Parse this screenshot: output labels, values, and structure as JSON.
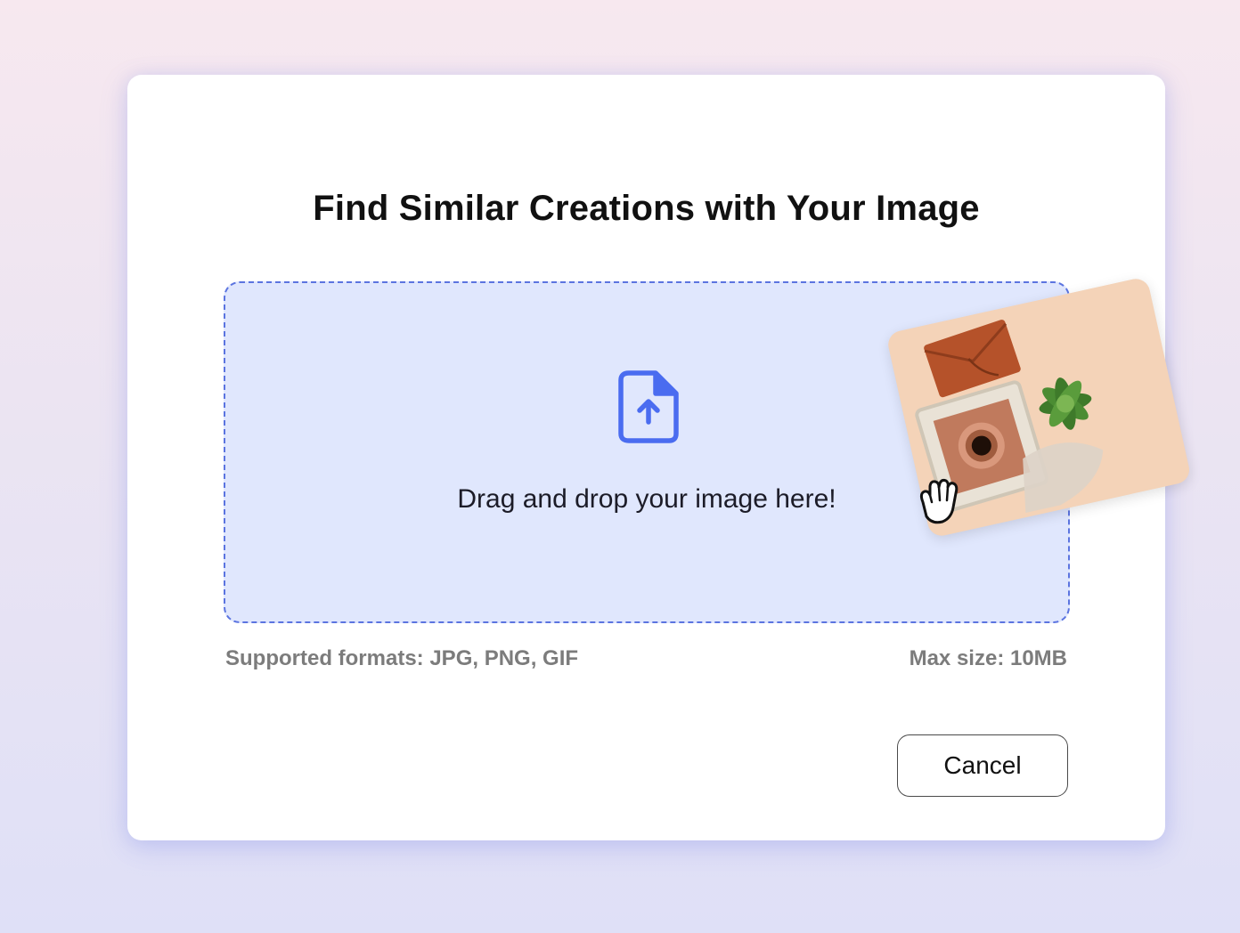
{
  "dialog": {
    "title": "Find Similar Creations with Your Image",
    "dropzone": {
      "instruction": "Drag and drop your image here!",
      "icon": "file-upload-icon"
    },
    "supported_formats": "Supported formats: JPG, PNG, GIF",
    "max_size": "Max size: 10MB",
    "cancel_label": "Cancel"
  },
  "drag_preview": {
    "description_icon": "dragged-image-thumbnail",
    "cursor_icon": "grab-hand-icon"
  },
  "colors": {
    "accent": "#4a6cf0",
    "dropzone_bg": "#e0e7fd",
    "dropzone_border": "#5b74e0",
    "muted_text": "#7c7c7c"
  }
}
